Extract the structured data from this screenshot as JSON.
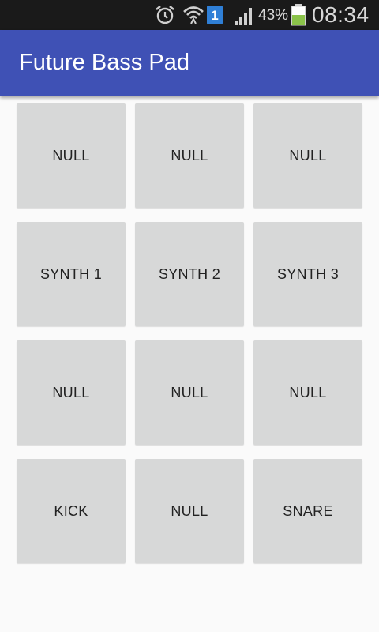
{
  "status_bar": {
    "icons": [
      "alarm-icon",
      "wifi-icon",
      "sim-1-icon",
      "signal-icon",
      "battery-icon"
    ],
    "sim_number": "1",
    "battery_percent": "43%",
    "time": "08:34"
  },
  "app_bar": {
    "title": "Future Bass Pad",
    "color": "#3f51b5"
  },
  "pads": [
    {
      "label": "NULL"
    },
    {
      "label": "NULL"
    },
    {
      "label": "NULL"
    },
    {
      "label": "SYNTH 1"
    },
    {
      "label": "SYNTH 2"
    },
    {
      "label": "SYNTH 3"
    },
    {
      "label": "NULL"
    },
    {
      "label": "NULL"
    },
    {
      "label": "NULL"
    },
    {
      "label": "KICK"
    },
    {
      "label": "NULL"
    },
    {
      "label": "SNARE"
    }
  ]
}
